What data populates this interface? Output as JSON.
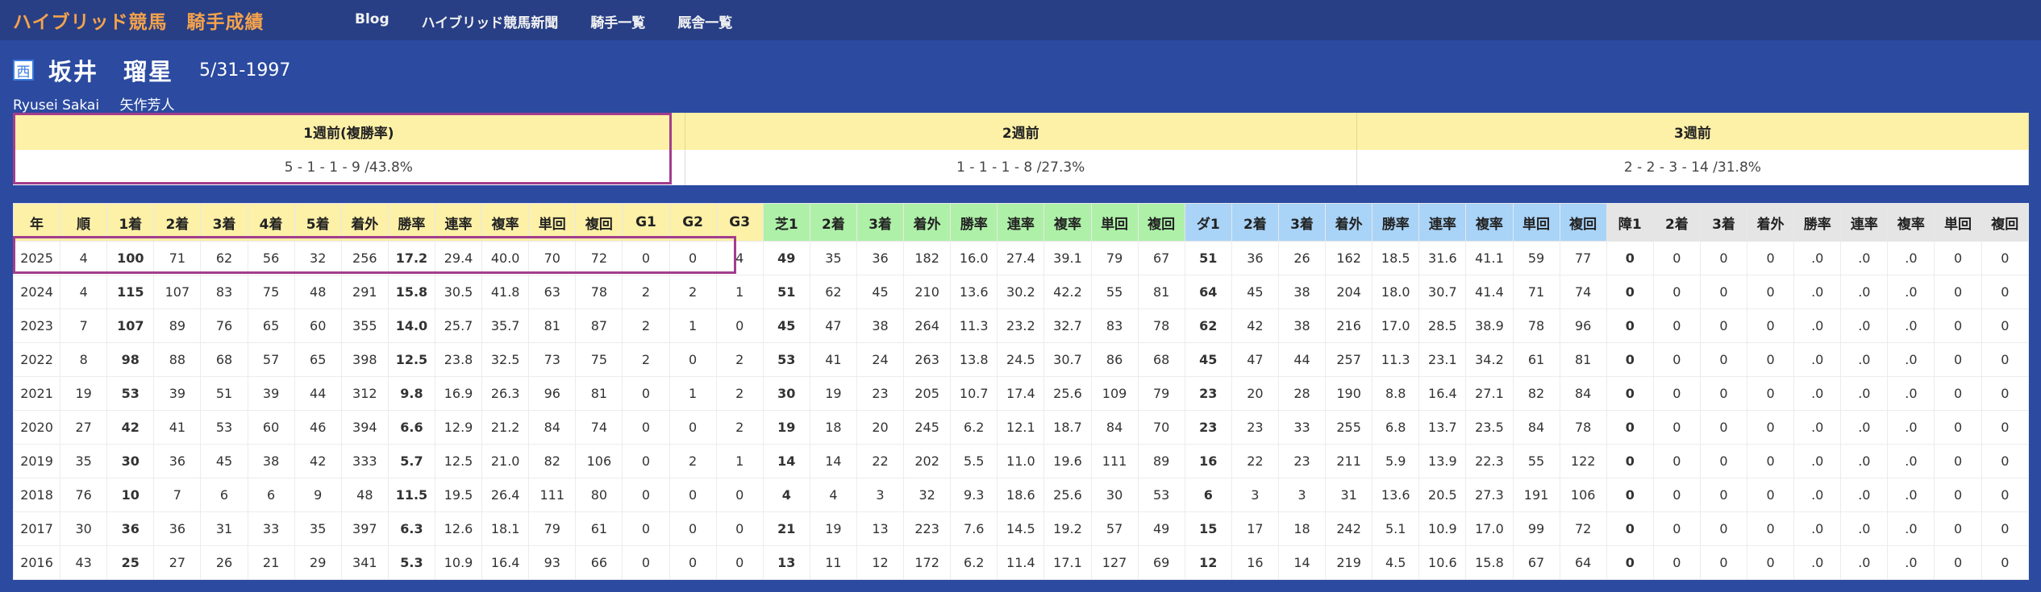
{
  "brand": "ハイブリッド競馬　騎手成績",
  "nav": [
    "Blog",
    "ハイブリッド競馬新聞",
    "騎手一覧",
    "厩舎一覧"
  ],
  "jockey": {
    "region_badge": "西",
    "name": "坂井　瑠星",
    "dob": "5/31-1997",
    "romaji": "Ryusei Sakai",
    "trainer": "矢作芳人"
  },
  "weekly": {
    "headers": [
      "1週前(複勝率)",
      "2週前",
      "3週前"
    ],
    "values": [
      "5 - 1 - 1 - 9 /43.8%",
      "1 - 1 - 1 - 8 /27.3%",
      "2 - 2 - 3 - 14 /31.8%"
    ]
  },
  "stats": {
    "headers": [
      "年",
      "順",
      "1着",
      "2着",
      "3着",
      "4着",
      "5着",
      "着外",
      "勝率",
      "連率",
      "複率",
      "単回",
      "複回",
      "G1",
      "G2",
      "G3",
      "芝1",
      "2着",
      "3着",
      "着外",
      "勝率",
      "連率",
      "複率",
      "単回",
      "複回",
      "ダ1",
      "2着",
      "3着",
      "着外",
      "勝率",
      "連率",
      "複率",
      "単回",
      "複回",
      "障1",
      "2着",
      "3着",
      "着外",
      "勝率",
      "連率",
      "複率",
      "単回",
      "複回"
    ],
    "rows": [
      [
        "2025",
        "4",
        "100",
        "71",
        "62",
        "56",
        "32",
        "256",
        "17.2",
        "29.4",
        "40.0",
        "70",
        "72",
        "0",
        "0",
        "4",
        "49",
        "35",
        "36",
        "182",
        "16.0",
        "27.4",
        "39.1",
        "79",
        "67",
        "51",
        "36",
        "26",
        "162",
        "18.5",
        "31.6",
        "41.1",
        "59",
        "77",
        "0",
        "0",
        "0",
        "0",
        ".0",
        ".0",
        ".0",
        "0",
        "0"
      ],
      [
        "2024",
        "4",
        "115",
        "107",
        "83",
        "75",
        "48",
        "291",
        "15.8",
        "30.5",
        "41.8",
        "63",
        "78",
        "2",
        "2",
        "1",
        "51",
        "62",
        "45",
        "210",
        "13.6",
        "30.2",
        "42.2",
        "55",
        "81",
        "64",
        "45",
        "38",
        "204",
        "18.0",
        "30.7",
        "41.4",
        "71",
        "74",
        "0",
        "0",
        "0",
        "0",
        ".0",
        ".0",
        ".0",
        "0",
        "0"
      ],
      [
        "2023",
        "7",
        "107",
        "89",
        "76",
        "65",
        "60",
        "355",
        "14.0",
        "25.7",
        "35.7",
        "81",
        "87",
        "2",
        "1",
        "0",
        "45",
        "47",
        "38",
        "264",
        "11.3",
        "23.2",
        "32.7",
        "83",
        "78",
        "62",
        "42",
        "38",
        "216",
        "17.0",
        "28.5",
        "38.9",
        "78",
        "96",
        "0",
        "0",
        "0",
        "0",
        ".0",
        ".0",
        ".0",
        "0",
        "0"
      ],
      [
        "2022",
        "8",
        "98",
        "88",
        "68",
        "57",
        "65",
        "398",
        "12.5",
        "23.8",
        "32.5",
        "73",
        "75",
        "2",
        "0",
        "2",
        "53",
        "41",
        "24",
        "263",
        "13.8",
        "24.5",
        "30.7",
        "86",
        "68",
        "45",
        "47",
        "44",
        "257",
        "11.3",
        "23.1",
        "34.2",
        "61",
        "81",
        "0",
        "0",
        "0",
        "0",
        ".0",
        ".0",
        ".0",
        "0",
        "0"
      ],
      [
        "2021",
        "19",
        "53",
        "39",
        "51",
        "39",
        "44",
        "312",
        "9.8",
        "16.9",
        "26.3",
        "96",
        "81",
        "0",
        "1",
        "2",
        "30",
        "19",
        "23",
        "205",
        "10.7",
        "17.4",
        "25.6",
        "109",
        "79",
        "23",
        "20",
        "28",
        "190",
        "8.8",
        "16.4",
        "27.1",
        "82",
        "84",
        "0",
        "0",
        "0",
        "0",
        ".0",
        ".0",
        ".0",
        "0",
        "0"
      ],
      [
        "2020",
        "27",
        "42",
        "41",
        "53",
        "60",
        "46",
        "394",
        "6.6",
        "12.9",
        "21.2",
        "84",
        "74",
        "0",
        "0",
        "2",
        "19",
        "18",
        "20",
        "245",
        "6.2",
        "12.1",
        "18.7",
        "84",
        "70",
        "23",
        "23",
        "33",
        "255",
        "6.8",
        "13.7",
        "23.5",
        "84",
        "78",
        "0",
        "0",
        "0",
        "0",
        ".0",
        ".0",
        ".0",
        "0",
        "0"
      ],
      [
        "2019",
        "35",
        "30",
        "36",
        "45",
        "38",
        "42",
        "333",
        "5.7",
        "12.5",
        "21.0",
        "82",
        "106",
        "0",
        "2",
        "1",
        "14",
        "14",
        "22",
        "202",
        "5.5",
        "11.0",
        "19.6",
        "111",
        "89",
        "16",
        "22",
        "23",
        "211",
        "5.9",
        "13.9",
        "22.3",
        "55",
        "122",
        "0",
        "0",
        "0",
        "0",
        ".0",
        ".0",
        ".0",
        "0",
        "0"
      ],
      [
        "2018",
        "76",
        "10",
        "7",
        "6",
        "6",
        "9",
        "48",
        "11.5",
        "19.5",
        "26.4",
        "111",
        "80",
        "0",
        "0",
        "0",
        "4",
        "4",
        "3",
        "32",
        "9.3",
        "18.6",
        "25.6",
        "30",
        "53",
        "6",
        "3",
        "3",
        "31",
        "13.6",
        "20.5",
        "27.3",
        "191",
        "106",
        "0",
        "0",
        "0",
        "0",
        ".0",
        ".0",
        ".0",
        "0",
        "0"
      ],
      [
        "2017",
        "30",
        "36",
        "36",
        "31",
        "33",
        "35",
        "397",
        "6.3",
        "12.6",
        "18.1",
        "79",
        "61",
        "0",
        "0",
        "0",
        "21",
        "19",
        "13",
        "223",
        "7.6",
        "14.5",
        "19.2",
        "57",
        "49",
        "15",
        "17",
        "18",
        "242",
        "5.1",
        "10.9",
        "17.0",
        "99",
        "72",
        "0",
        "0",
        "0",
        "0",
        ".0",
        ".0",
        ".0",
        "0",
        "0"
      ],
      [
        "2016",
        "43",
        "25",
        "27",
        "26",
        "21",
        "29",
        "341",
        "5.3",
        "10.9",
        "16.4",
        "93",
        "66",
        "0",
        "0",
        "0",
        "13",
        "11",
        "12",
        "172",
        "6.2",
        "11.4",
        "17.1",
        "127",
        "69",
        "12",
        "16",
        "14",
        "219",
        "4.5",
        "10.6",
        "15.8",
        "67",
        "64",
        "0",
        "0",
        "0",
        "0",
        ".0",
        ".0",
        ".0",
        "0",
        "0"
      ]
    ]
  },
  "colors": {
    "background": "#2b4aa0",
    "brand": "#f4a24c",
    "header_all": "#fdf0a7",
    "header_turf": "#aef0a8",
    "header_dirt": "#a9d3f7",
    "header_jump": "#e5e5e5",
    "highlight": "#a23d8e"
  }
}
